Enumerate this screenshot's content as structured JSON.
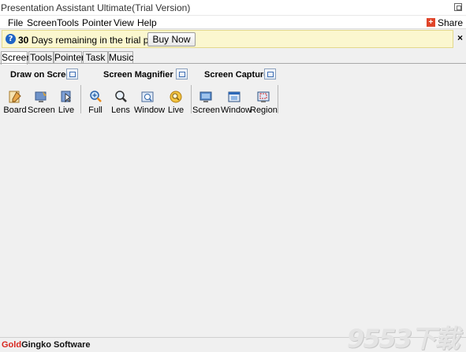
{
  "window": {
    "title": "Presentation Assistant Ultimate(Trial Version)"
  },
  "menu": {
    "items": [
      "File",
      "Screen",
      "Tools",
      "Pointer",
      "View",
      "Help"
    ],
    "share_label": "Share"
  },
  "notice": {
    "days": "30",
    "message": "Days remaining in the trial period :)",
    "buy_label": "Buy Now",
    "close_label": "×"
  },
  "tabs": [
    "Screen",
    "Tools",
    "Pointer",
    "Task",
    "Music"
  ],
  "ribbon": {
    "groups": [
      {
        "title": "Draw on Screen",
        "tools": [
          "Board",
          "Screen",
          "Live"
        ]
      },
      {
        "title": "Screen Magnifier",
        "tools": [
          "Full",
          "Lens",
          "Window",
          "Live"
        ]
      },
      {
        "title": "Screen Capture",
        "tools": [
          "Screen",
          "Window",
          "Region"
        ]
      }
    ]
  },
  "status": {
    "brand_gold": "Gold",
    "brand_rest": "Gingko Software"
  },
  "watermark": {
    "text": "9553下载"
  },
  "colors": {
    "notice_bg": "#fbf7cf",
    "brand_red": "#d8271f",
    "info_blue": "#1f64c6"
  }
}
